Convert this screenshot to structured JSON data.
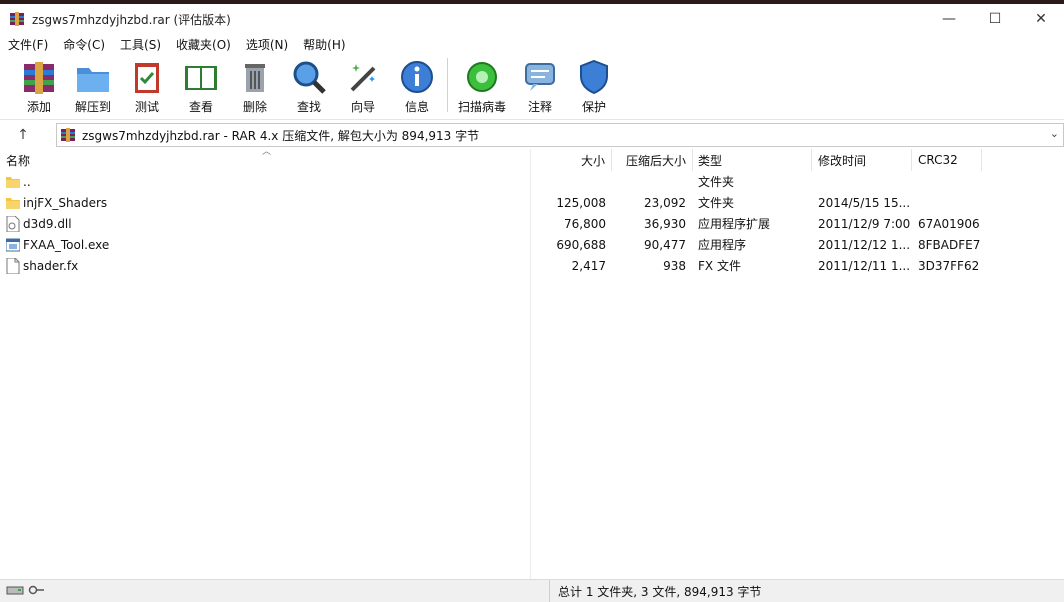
{
  "window": {
    "title": "zsgws7mhzdyjhzbd.rar (评估版本)",
    "controls": {
      "minimize": "—",
      "maximize": "☐",
      "close": "✕"
    }
  },
  "menu": [
    "文件(F)",
    "命令(C)",
    "工具(S)",
    "收藏夹(O)",
    "选项(N)",
    "帮助(H)"
  ],
  "toolbar": {
    "add": "添加",
    "extract": "解压到",
    "test": "测试",
    "view": "查看",
    "delete": "删除",
    "find": "查找",
    "wizard": "向导",
    "info": "信息",
    "scan": "扫描病毒",
    "comment": "注释",
    "protect": "保护"
  },
  "address": {
    "path": "zsgws7mhzdyjhzbd.rar - RAR 4.x 压缩文件, 解包大小为 894,913 字节"
  },
  "columns": {
    "name": "名称",
    "size": "大小",
    "packed": "压缩后大小",
    "type": "类型",
    "modified": "修改时间",
    "crc": "CRC32"
  },
  "files": [
    {
      "name": "..",
      "size": "",
      "packed": "",
      "type": "文件夹",
      "modified": "",
      "crc": "",
      "icon": "folder-icon"
    },
    {
      "name": "injFX_Shaders",
      "size": "125,008",
      "packed": "23,092",
      "type": "文件夹",
      "modified": "2014/5/15 15...",
      "crc": "",
      "icon": "folder-icon"
    },
    {
      "name": "d3d9.dll",
      "size": "76,800",
      "packed": "36,930",
      "type": "应用程序扩展",
      "modified": "2011/12/9 7:00",
      "crc": "67A01906",
      "icon": "dll-file-icon"
    },
    {
      "name": "FXAA_Tool.exe",
      "size": "690,688",
      "packed": "90,477",
      "type": "应用程序",
      "modified": "2011/12/12 1...",
      "crc": "8FBADFE7",
      "icon": "exe-file-icon"
    },
    {
      "name": "shader.fx",
      "size": "2,417",
      "packed": "938",
      "type": "FX 文件",
      "modified": "2011/12/11 1...",
      "crc": "3D37FF62",
      "icon": "file-icon"
    }
  ],
  "status": {
    "summary": "总计 1 文件夹, 3 文件, 894,913 字节"
  },
  "colors": {
    "folder": "#f5c542",
    "accent": "#1e6fd9"
  }
}
